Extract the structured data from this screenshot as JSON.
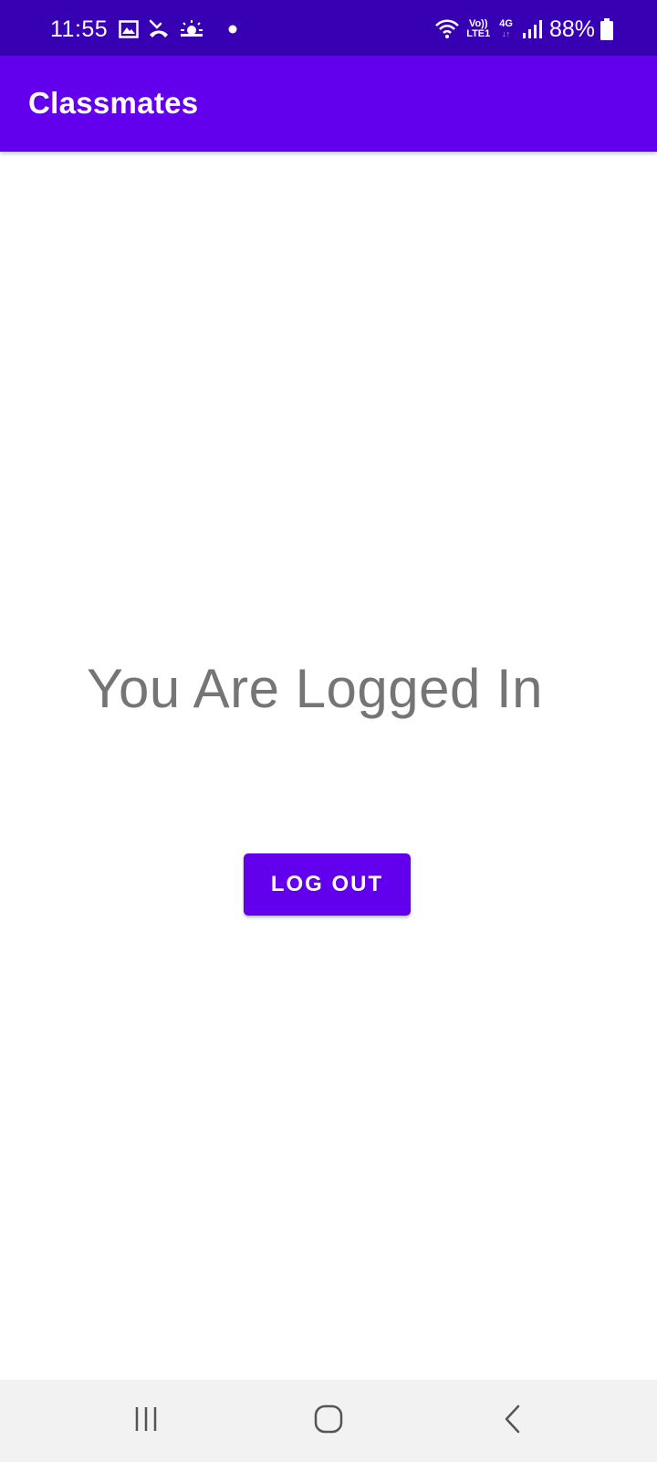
{
  "status_bar": {
    "time": "11:55",
    "left_icons": [
      "gallery-icon",
      "missed-call-icon",
      "weather-icon",
      "notification-dot-icon"
    ],
    "volte_top": "Vo))",
    "volte_bottom": "LTE1",
    "network_type": "4G",
    "network_arrows": "↓↑",
    "battery_percent": "88%",
    "background_color": "#3700b3"
  },
  "app_bar": {
    "title": "Classmates",
    "background_color": "#6200ee"
  },
  "main": {
    "status_message": "You Are Logged In",
    "logout_label": "LOG OUT",
    "button_color": "#6200ee",
    "text_color": "#757575"
  },
  "nav_bar": {
    "recents_icon": "recents-icon",
    "home_icon": "home-icon",
    "back_icon": "back-icon"
  }
}
